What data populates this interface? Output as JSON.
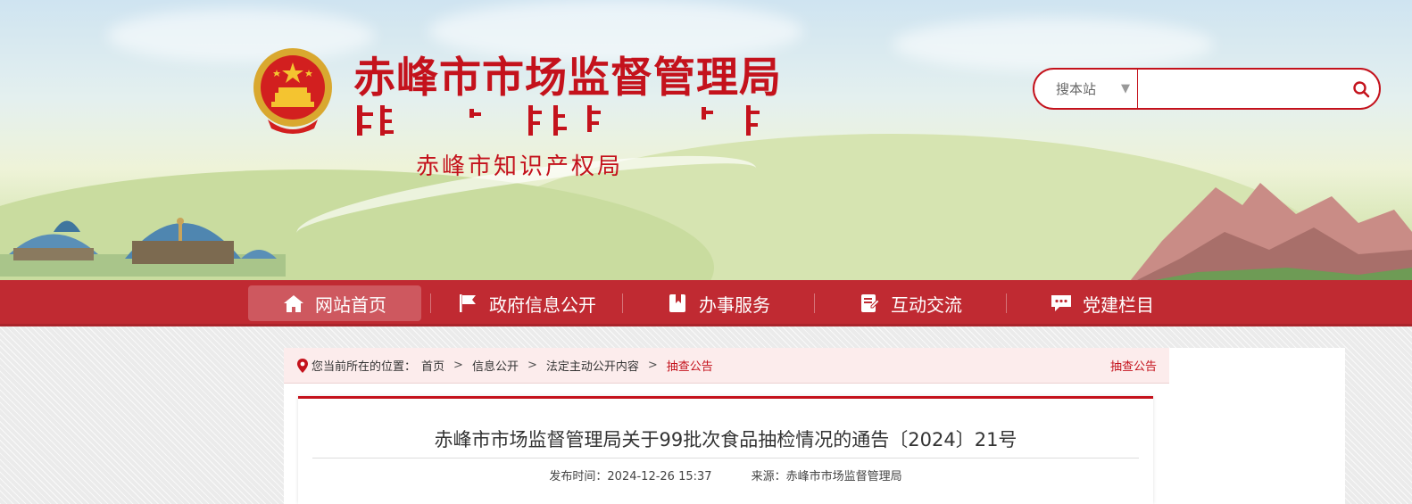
{
  "header": {
    "site_title": "赤峰市市场监督管理局",
    "sub_title": "赤峰市知识产权局",
    "emblem_icon": "national-emblem-icon",
    "accent_color": "#c4121c"
  },
  "search": {
    "scope_label": "搜本站",
    "placeholder": "",
    "scope_icon": "triangle-down-icon",
    "button_icon": "search-icon"
  },
  "nav": {
    "items": [
      {
        "label": "网站首页",
        "icon": "home-icon",
        "active": true
      },
      {
        "label": "政府信息公开",
        "icon": "flag-icon"
      },
      {
        "label": "办事服务",
        "icon": "bookmark-icon"
      },
      {
        "label": "互动交流",
        "icon": "edit-note-icon"
      },
      {
        "label": "党建栏目",
        "icon": "chat-icon"
      }
    ],
    "bg_color": "#c02a32"
  },
  "breadcrumb": {
    "prefix": "您当前所在的位置：",
    "items": [
      "首页",
      "信息公开",
      "法定主动公开内容"
    ],
    "current": "抽查公告",
    "right_label": "抽查公告"
  },
  "article": {
    "title": "赤峰市市场监督管理局关于99批次食品抽检情况的通告〔2024〕21号",
    "publish_time": "发布时间：2024-12-26 15:37",
    "source": "来源：赤峰市市场监督管理局"
  }
}
